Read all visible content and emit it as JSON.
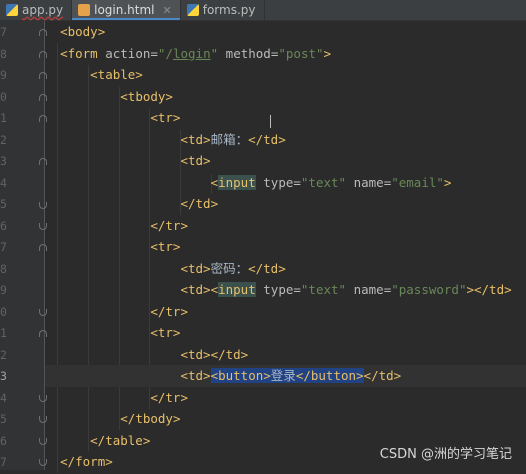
{
  "tabs": [
    {
      "label": "app.py",
      "type": "python",
      "error": true
    },
    {
      "label": "login.html",
      "type": "html",
      "active": true
    },
    {
      "label": "forms.py",
      "type": "python"
    }
  ],
  "line_numbers": [
    "7",
    "8",
    "9",
    "0",
    "1",
    "2",
    "3",
    "4",
    "5",
    "6",
    "7",
    "8",
    "9",
    "0",
    "1",
    "2",
    "3",
    "4",
    "5",
    "6",
    "7"
  ],
  "code": {
    "l1": {
      "t1": "<body>"
    },
    "l2": {
      "t1": "<form",
      "a1": " action=",
      "v1a": "\"/",
      "v1u": "login",
      "v1b": "\"",
      "a2": " method=",
      "v2": "\"post\"",
      "t2": ">"
    },
    "l3": {
      "t1": "<table>"
    },
    "l4": {
      "t1": "<tbody>"
    },
    "l5": {
      "t1": "<tr>"
    },
    "l6": {
      "t1": "<td>",
      "x1": "邮箱：",
      "t2": "</td>"
    },
    "l7": {
      "t1": "<td>"
    },
    "l8": {
      "t1": "<",
      "t1b": "input",
      "a1": " type=",
      "v1": "\"text\"",
      "a2": " name=",
      "v2": "\"email\"",
      "t2": ">"
    },
    "l9": {
      "t1": "</td>"
    },
    "l10": {
      "t1": "</tr>"
    },
    "l11": {
      "t1": "<tr>"
    },
    "l12": {
      "t1": "<td>",
      "x1": "密码：",
      "t2": "</td>"
    },
    "l13": {
      "t1": "<td><",
      "t1b": "input",
      "a1": " type=",
      "v1": "\"text\"",
      "a2": " name=",
      "v2": "\"password\"",
      "t2": "></td>"
    },
    "l14": {
      "t1": "</tr>"
    },
    "l15": {
      "t1": "<tr>"
    },
    "l16": {
      "t1": "<td></td>"
    },
    "l17": {
      "t1": "<td>",
      "s1": "<button>",
      "x1": "登录",
      "s2": "</button>",
      "t2": "</td>"
    },
    "l18": {
      "t1": "</tr>"
    },
    "l19": {
      "t1": "</tbody>"
    },
    "l20": {
      "t1": "</table>"
    },
    "l21": {
      "t1": "</form>"
    }
  },
  "current_line": 17,
  "watermark": "CSDN @洲的学习笔记"
}
